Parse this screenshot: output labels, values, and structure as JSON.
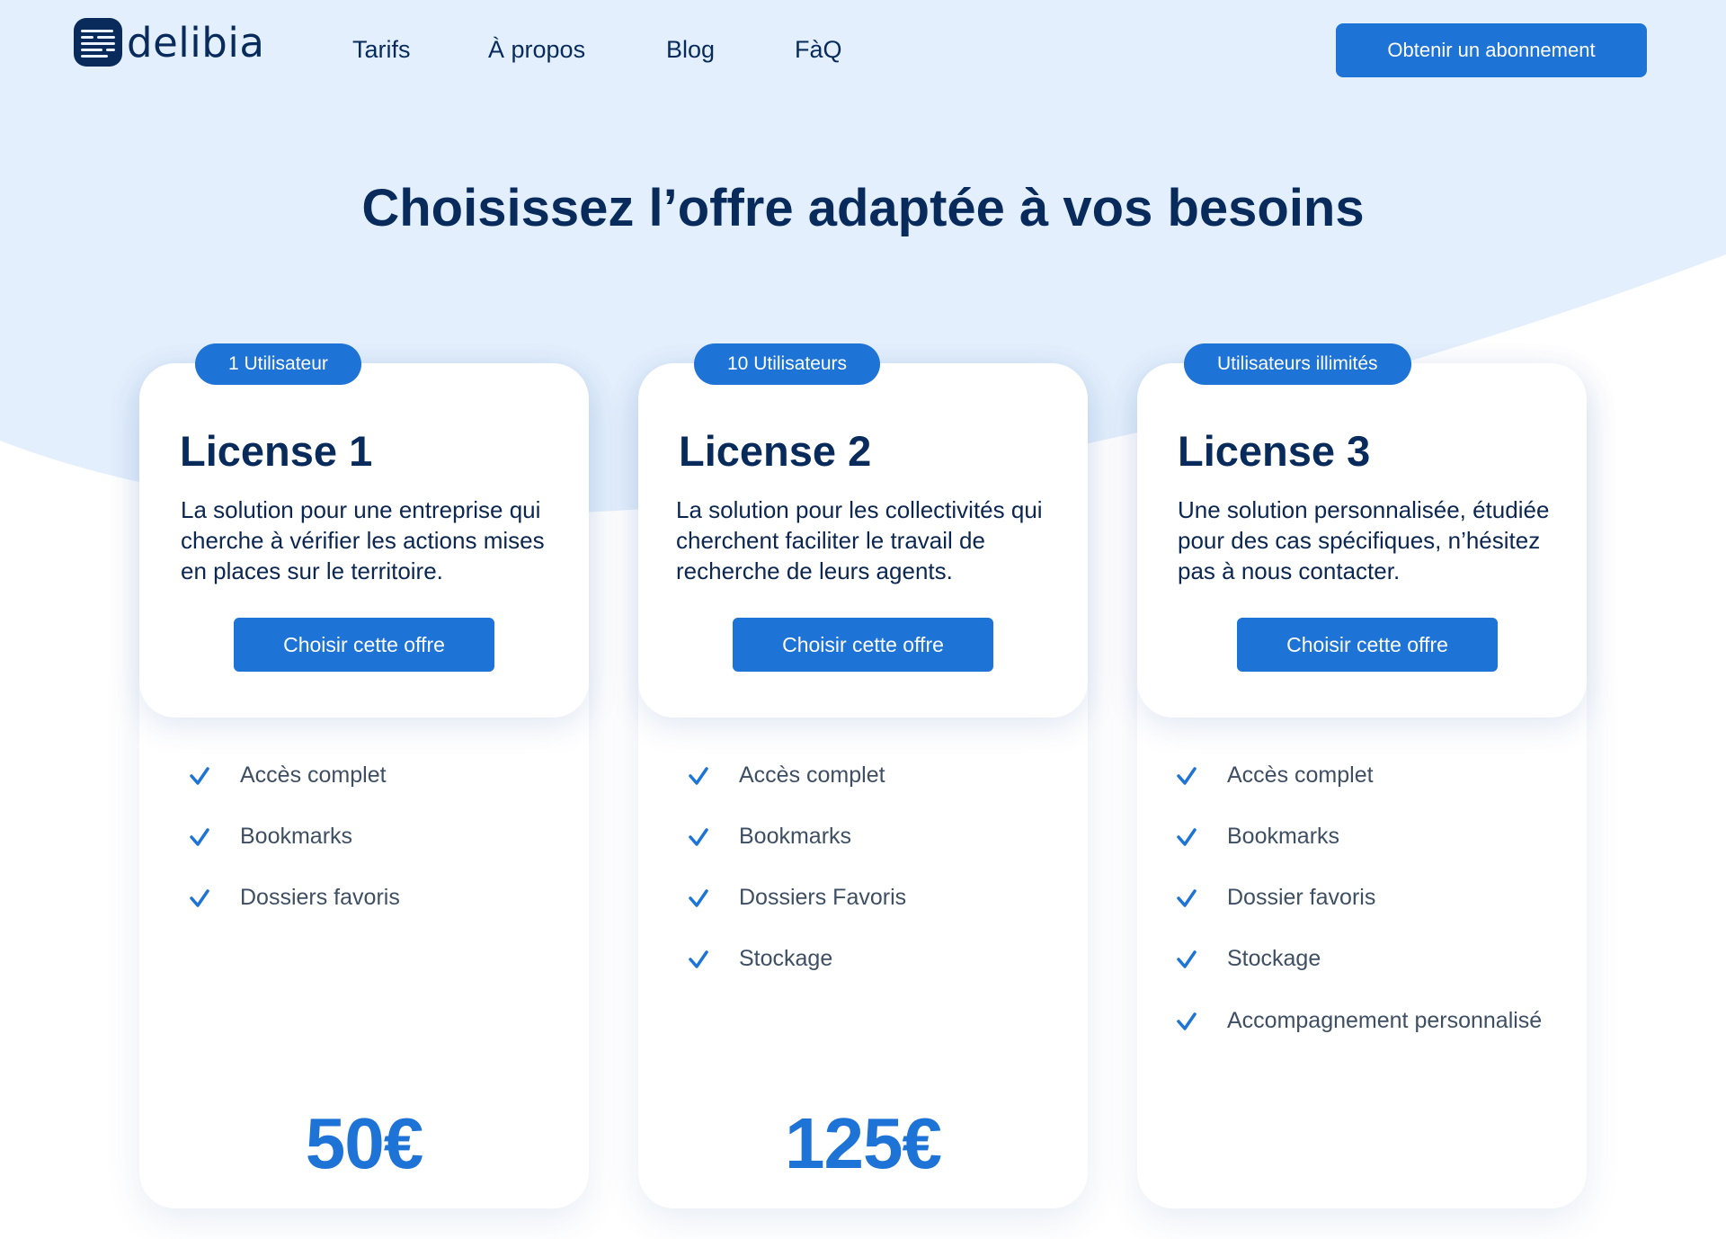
{
  "brand": {
    "name": "delibia"
  },
  "nav": {
    "items": [
      "Tarifs",
      "À propos",
      "Blog",
      "FàQ"
    ],
    "cta": "Obtenir un abonnement"
  },
  "hero": {
    "title": "Choisissez l’offre adaptée à vos besoins"
  },
  "plans": [
    {
      "badge": "1 Utilisateur",
      "title": "License 1",
      "description": "La solution pour une entreprise qui cherche à vérifier les actions mises en places sur le territoire.",
      "button": "Choisir cette offre",
      "features": [
        "Accès complet",
        "Bookmarks",
        "Dossiers favoris"
      ],
      "price": "50€"
    },
    {
      "badge": "10 Utilisateurs",
      "title": "License 2",
      "description": "La solution pour les collectivités qui cherchent faciliter le travail de recherche de leurs agents.",
      "button": "Choisir cette offre",
      "features": [
        "Accès complet",
        "Bookmarks",
        "Dossiers Favoris",
        "Stockage"
      ],
      "price": "125€"
    },
    {
      "badge": "Utilisateurs illimités",
      "title": "License 3",
      "description": "Une solution personnalisée, étudiée pour des cas spécifiques, n’hésitez pas à nous contacter.",
      "button": "Choisir cette offre",
      "features": [
        "Accès complet",
        "Bookmarks",
        "Dossier favoris",
        "Stockage",
        "Accompagnement personnalisé"
      ],
      "price": ""
    }
  ],
  "colors": {
    "primary": "#1e73d6",
    "navy": "#082b5c",
    "background_blue": "#e3effc",
    "feature_text": "#3e4f63"
  },
  "icons": {
    "feature": "check-icon",
    "logo": "document-lines-icon"
  }
}
